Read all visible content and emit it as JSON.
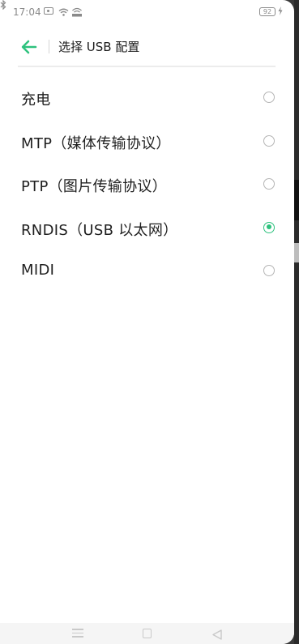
{
  "status_bar": {
    "time": "17:04",
    "battery": "92",
    "icons": [
      "photo-icon",
      "wifi-icon",
      "vpn-icon",
      "bluetooth-icon",
      "battery-icon",
      "charging-icon"
    ]
  },
  "header": {
    "title": "选择 USB 配置",
    "back_icon": "arrow-left-icon"
  },
  "options": [
    {
      "label": "充电",
      "selected": false
    },
    {
      "label": "MTP（媒体传输协议）",
      "selected": false
    },
    {
      "label": "PTP（图片传输协议）",
      "selected": false
    },
    {
      "label": "RNDIS（USB 以太网）",
      "selected": true
    },
    {
      "label": "MIDI",
      "selected": false
    }
  ],
  "colors": {
    "accent": "#2ec27e",
    "text": "#1f1f1f",
    "muted": "#8a8a8a"
  },
  "nav_bar": {
    "icons": [
      "menu-icon",
      "home-icon",
      "back-icon"
    ]
  }
}
